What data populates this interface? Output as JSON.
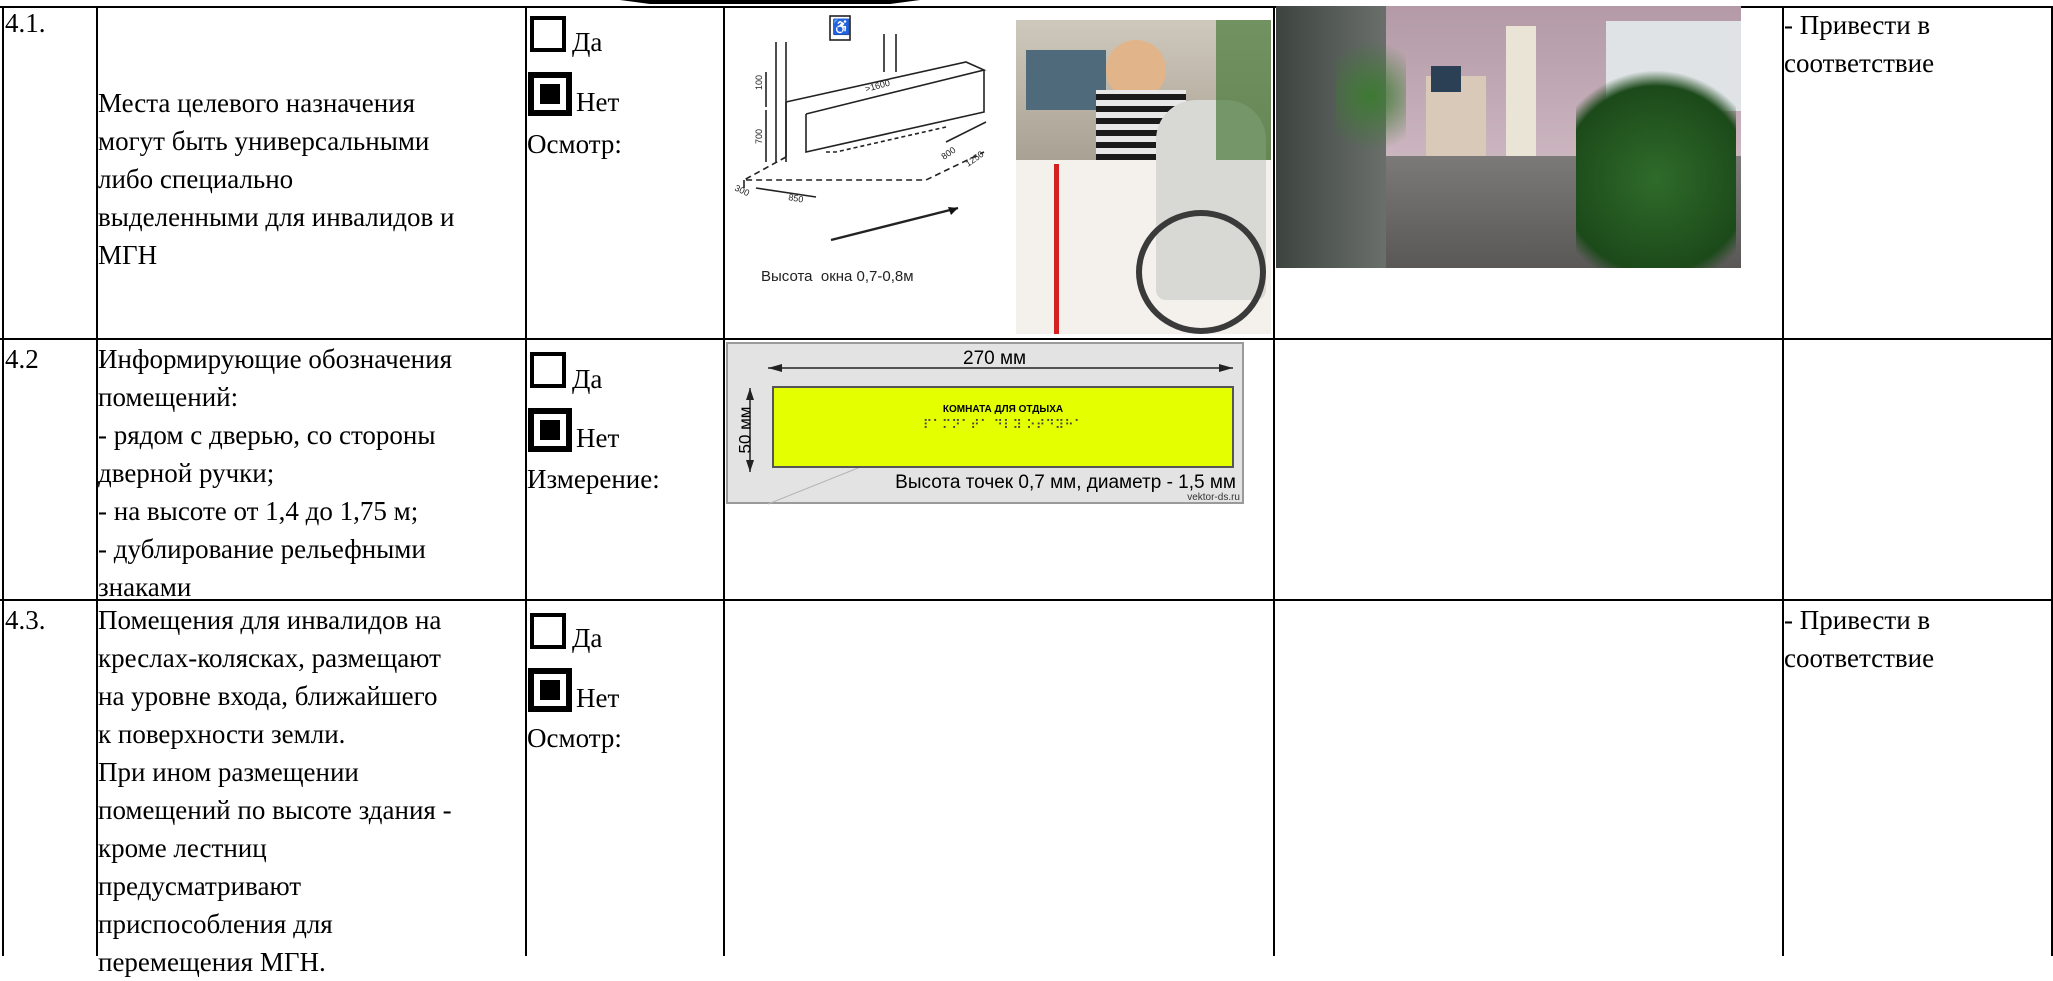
{
  "rows": [
    {
      "num": "4.1.",
      "description": "Места целевого назначения\nмогут быть универсальными\nлибо специально\nвыделенными для инвалидов и\nМГН",
      "option_yes": "Да",
      "option_no": "Нет",
      "yes_checked": false,
      "no_checked": true,
      "method": "Осмотр:",
      "figure_caption": "Высота  окна 0,7-0,8м",
      "recommendation": "- Привести в\nсоответствие"
    },
    {
      "num": "4.2",
      "description": "Информирующие обозначения\nпомещений:\n- рядом с дверью, со стороны\nдверной ручки;\n- на высоте от 1,4 до 1,75 м;\n- дублирование рельефными\nзнаками",
      "option_yes": "Да",
      "option_no": "Нет",
      "yes_checked": false,
      "no_checked": true,
      "method": "Измерение:",
      "sign_width_label": "270 мм",
      "sign_height_label": "50 мм",
      "sign_title": "КОМНАТА ДЛЯ ОТДЫХА",
      "sign_braille": "⠏⠁⠍⠝⠁⠞⠁ ⠙⠇⠽ ⠕⠞⠙⠽⠓⠁",
      "sign_caption": "Высота точек 0,7 мм, диаметр - 1,5 мм",
      "sign_watermark": "vektor-ds.ru",
      "recommendation": ""
    },
    {
      "num": "4.3.",
      "description": "Помещения для инвалидов на\nкреслах-колясках, размещают\nна уровне входа, ближайшего\nк поверхности земли.\n При ином размещении\nпомещений по высоте здания -\nкроме лестниц\nпредусматривают\nприспособления для\nперемещения МГН.",
      "option_yes": "Да",
      "option_no": "Нет",
      "yes_checked": false,
      "no_checked": true,
      "method": "Осмотр:",
      "recommendation": "- Привести в\nсоответствие"
    }
  ],
  "drawing_labels": {
    "d1": ">1600",
    "d2": "100",
    "d3": "700",
    "d4": "800",
    "d5": "1250",
    "d6": "850",
    "d7": "300"
  },
  "colors": {
    "sign_yellow": "#e4ff00",
    "pole_red": "#d42020",
    "wall_pink": "#c9a9b8",
    "plant_green": "#2f6b2a"
  },
  "icons": {
    "wheelchair": "wheelchair-icon"
  }
}
